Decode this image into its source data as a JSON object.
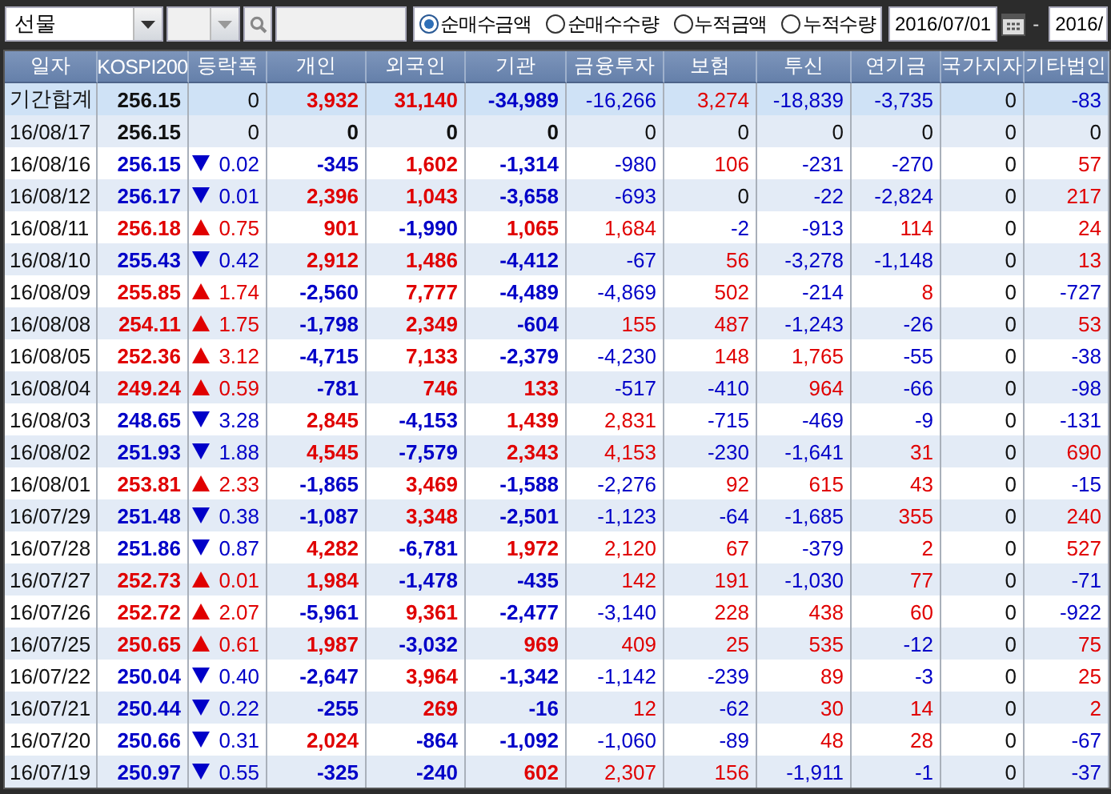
{
  "toolbar": {
    "market": "선물",
    "radios": [
      {
        "label": "순매수금액",
        "selected": true
      },
      {
        "label": "순매수수량",
        "selected": false
      },
      {
        "label": "누적금액",
        "selected": false
      },
      {
        "label": "누적수량",
        "selected": false
      }
    ],
    "date_from": "2016/07/01",
    "date_separator": "-",
    "date_to": "2016/"
  },
  "table": {
    "columns": [
      "일자",
      "KOSPI200",
      "등락폭",
      "개인",
      "외국인",
      "기관",
      "금융투자",
      "보험",
      "투신",
      "연기금",
      "국가지자",
      "기타법인"
    ],
    "rows": [
      {
        "kind": "total",
        "date": "기간합계",
        "kospi": "256.15",
        "up": false,
        "down": false,
        "change": "0",
        "values": [
          "3,932",
          "31,140",
          "-34,989",
          "-16,266",
          "3,274",
          "-18,839",
          "-3,735",
          "0",
          "-83"
        ]
      },
      {
        "kind": "day",
        "date": "16/08/17",
        "kospi": "256.15",
        "up": false,
        "down": false,
        "change": "0",
        "values": [
          "0",
          "0",
          "0",
          "0",
          "0",
          "0",
          "0",
          "0",
          "0"
        ]
      },
      {
        "kind": "day",
        "date": "16/08/16",
        "kospi": "256.15",
        "up": false,
        "down": true,
        "change": "0.02",
        "values": [
          "-345",
          "1,602",
          "-1,314",
          "-980",
          "106",
          "-231",
          "-270",
          "0",
          "57"
        ]
      },
      {
        "kind": "day",
        "date": "16/08/12",
        "kospi": "256.17",
        "up": false,
        "down": true,
        "change": "0.01",
        "values": [
          "2,396",
          "1,043",
          "-3,658",
          "-693",
          "0",
          "-22",
          "-2,824",
          "0",
          "217"
        ]
      },
      {
        "kind": "day",
        "date": "16/08/11",
        "kospi": "256.18",
        "up": true,
        "down": false,
        "change": "0.75",
        "values": [
          "901",
          "-1,990",
          "1,065",
          "1,684",
          "-2",
          "-913",
          "114",
          "0",
          "24"
        ]
      },
      {
        "kind": "day",
        "date": "16/08/10",
        "kospi": "255.43",
        "up": false,
        "down": true,
        "change": "0.42",
        "values": [
          "2,912",
          "1,486",
          "-4,412",
          "-67",
          "56",
          "-3,278",
          "-1,148",
          "0",
          "13"
        ]
      },
      {
        "kind": "day",
        "date": "16/08/09",
        "kospi": "255.85",
        "up": true,
        "down": false,
        "change": "1.74",
        "values": [
          "-2,560",
          "7,777",
          "-4,489",
          "-4,869",
          "502",
          "-214",
          "8",
          "0",
          "-727"
        ]
      },
      {
        "kind": "day",
        "date": "16/08/08",
        "kospi": "254.11",
        "up": true,
        "down": false,
        "change": "1.75",
        "values": [
          "-1,798",
          "2,349",
          "-604",
          "155",
          "487",
          "-1,243",
          "-26",
          "0",
          "53"
        ]
      },
      {
        "kind": "day",
        "date": "16/08/05",
        "kospi": "252.36",
        "up": true,
        "down": false,
        "change": "3.12",
        "values": [
          "-4,715",
          "7,133",
          "-2,379",
          "-4,230",
          "148",
          "1,765",
          "-55",
          "0",
          "-38"
        ]
      },
      {
        "kind": "day",
        "date": "16/08/04",
        "kospi": "249.24",
        "up": true,
        "down": false,
        "change": "0.59",
        "values": [
          "-781",
          "746",
          "133",
          "-517",
          "-410",
          "964",
          "-66",
          "0",
          "-98"
        ]
      },
      {
        "kind": "day",
        "date": "16/08/03",
        "kospi": "248.65",
        "up": false,
        "down": true,
        "change": "3.28",
        "values": [
          "2,845",
          "-4,153",
          "1,439",
          "2,831",
          "-715",
          "-469",
          "-9",
          "0",
          "-131"
        ]
      },
      {
        "kind": "day",
        "date": "16/08/02",
        "kospi": "251.93",
        "up": false,
        "down": true,
        "change": "1.88",
        "values": [
          "4,545",
          "-7,579",
          "2,343",
          "4,153",
          "-230",
          "-1,641",
          "31",
          "0",
          "690"
        ]
      },
      {
        "kind": "day",
        "date": "16/08/01",
        "kospi": "253.81",
        "up": true,
        "down": false,
        "change": "2.33",
        "values": [
          "-1,865",
          "3,469",
          "-1,588",
          "-2,276",
          "92",
          "615",
          "43",
          "0",
          "-15"
        ]
      },
      {
        "kind": "day",
        "date": "16/07/29",
        "kospi": "251.48",
        "up": false,
        "down": true,
        "change": "0.38",
        "values": [
          "-1,087",
          "3,348",
          "-2,501",
          "-1,123",
          "-64",
          "-1,685",
          "355",
          "0",
          "240"
        ]
      },
      {
        "kind": "day",
        "date": "16/07/28",
        "kospi": "251.86",
        "up": false,
        "down": true,
        "change": "0.87",
        "values": [
          "4,282",
          "-6,781",
          "1,972",
          "2,120",
          "67",
          "-379",
          "2",
          "0",
          "527"
        ]
      },
      {
        "kind": "day",
        "date": "16/07/27",
        "kospi": "252.73",
        "up": true,
        "down": false,
        "change": "0.01",
        "values": [
          "1,984",
          "-1,478",
          "-435",
          "142",
          "191",
          "-1,030",
          "77",
          "0",
          "-71"
        ]
      },
      {
        "kind": "day",
        "date": "16/07/26",
        "kospi": "252.72",
        "up": true,
        "down": false,
        "change": "2.07",
        "values": [
          "-5,961",
          "9,361",
          "-2,477",
          "-3,140",
          "228",
          "438",
          "60",
          "0",
          "-922"
        ]
      },
      {
        "kind": "day",
        "date": "16/07/25",
        "kospi": "250.65",
        "up": true,
        "down": false,
        "change": "0.61",
        "values": [
          "1,987",
          "-3,032",
          "969",
          "409",
          "25",
          "535",
          "-12",
          "0",
          "75"
        ]
      },
      {
        "kind": "day",
        "date": "16/07/22",
        "kospi": "250.04",
        "up": false,
        "down": true,
        "change": "0.40",
        "values": [
          "-2,647",
          "3,964",
          "-1,342",
          "-1,142",
          "-239",
          "89",
          "-3",
          "0",
          "25"
        ]
      },
      {
        "kind": "day",
        "date": "16/07/21",
        "kospi": "250.44",
        "up": false,
        "down": true,
        "change": "0.22",
        "values": [
          "-255",
          "269",
          "-16",
          "12",
          "-62",
          "30",
          "14",
          "0",
          "2"
        ]
      },
      {
        "kind": "day",
        "date": "16/07/20",
        "kospi": "250.66",
        "up": false,
        "down": true,
        "change": "0.31",
        "values": [
          "2,024",
          "-864",
          "-1,092",
          "-1,060",
          "-89",
          "48",
          "28",
          "0",
          "-67"
        ]
      },
      {
        "kind": "day",
        "date": "16/07/19",
        "kospi": "250.97",
        "up": false,
        "down": true,
        "change": "0.55",
        "values": [
          "-325",
          "-240",
          "602",
          "2,307",
          "156",
          "-1,911",
          "-1",
          "0",
          "-37"
        ]
      }
    ]
  }
}
